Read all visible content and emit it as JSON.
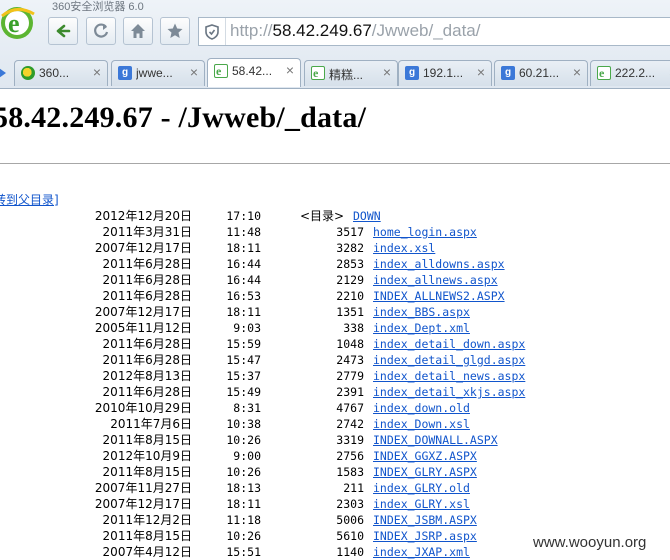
{
  "app": {
    "title": "360安全浏览器 6.0"
  },
  "address": {
    "prefix": "http://",
    "host": "58.42.249.67",
    "path": "/Jwweb/_data/"
  },
  "tabs": [
    {
      "label": "360...",
      "icon": "360-icon",
      "active": false
    },
    {
      "label": "jwwe...",
      "icon": "g-icon",
      "active": false
    },
    {
      "label": "58.42...",
      "icon": "page-icon",
      "active": true
    },
    {
      "label": "精糕...",
      "icon": "page-icon",
      "active": false
    },
    {
      "label": "192.1...",
      "icon": "g-icon",
      "active": false
    },
    {
      "label": "60.21...",
      "icon": "g-icon",
      "active": false
    },
    {
      "label": "222.2...",
      "icon": "page-icon",
      "active": false
    }
  ],
  "page": {
    "title": "58.42.249.67 - /Jwweb/_data/",
    "parent_link": "转到父目录]"
  },
  "listing": [
    {
      "date": "2012年12月20日",
      "time": "17:10",
      "dir_tag": "<目录>",
      "name": "DOWN"
    },
    {
      "date": "2011年3月31日",
      "time": "11:48",
      "size": "3517",
      "name": "home_login.aspx"
    },
    {
      "date": "2007年12月17日",
      "time": "18:11",
      "size": "3282",
      "name": "index.xsl"
    },
    {
      "date": "2011年6月28日",
      "time": "16:44",
      "size": "2853",
      "name": "index_alldowns.aspx"
    },
    {
      "date": "2011年6月28日",
      "time": "16:44",
      "size": "2129",
      "name": "index_allnews.aspx"
    },
    {
      "date": "2011年6月28日",
      "time": "16:53",
      "size": "2210",
      "name": "INDEX_ALLNEWS2.ASPX"
    },
    {
      "date": "2007年12月17日",
      "time": "18:11",
      "size": "1351",
      "name": "index_BBS.aspx"
    },
    {
      "date": "2005年11月12日",
      "time": "9:03",
      "size": "338",
      "name": "index_Dept.xml"
    },
    {
      "date": "2011年6月28日",
      "time": "15:59",
      "size": "1048",
      "name": "index_detail_down.aspx"
    },
    {
      "date": "2011年6月28日",
      "time": "15:47",
      "size": "2473",
      "name": "index_detail_glgd.aspx"
    },
    {
      "date": "2012年8月13日",
      "time": "15:37",
      "size": "2779",
      "name": "index_detail_news.aspx"
    },
    {
      "date": "2011年6月28日",
      "time": "15:49",
      "size": "2391",
      "name": "index_detail_xkjs.aspx"
    },
    {
      "date": "2010年10月29日",
      "time": "8:31",
      "size": "4767",
      "name": "index_down.old"
    },
    {
      "date": "2011年7月6日",
      "time": "10:38",
      "size": "2742",
      "name": "index_Down.xsl"
    },
    {
      "date": "2011年8月15日",
      "time": "10:26",
      "size": "3319",
      "name": "INDEX_DOWNALL.ASPX"
    },
    {
      "date": "2012年10月9日",
      "time": "9:00",
      "size": "2756",
      "name": "INDEX_GGXZ.ASPX"
    },
    {
      "date": "2011年8月15日",
      "time": "10:26",
      "size": "1583",
      "name": "INDEX_GLRY.ASPX"
    },
    {
      "date": "2007年11月27日",
      "time": "18:13",
      "size": "211",
      "name": "index_GLRY.old"
    },
    {
      "date": "2007年12月17日",
      "time": "18:11",
      "size": "2303",
      "name": "index_GLRY.xsl"
    },
    {
      "date": "2011年12月2日",
      "time": "11:18",
      "size": "5006",
      "name": "INDEX_JSBM.ASPX"
    },
    {
      "date": "2011年8月15日",
      "time": "10:26",
      "size": "5610",
      "name": "INDEX_JSRP.aspx"
    },
    {
      "date": "2007年4月12日",
      "time": "15:51",
      "size": "1140",
      "name": "index_JXAP.xml"
    }
  ],
  "watermark": "www.wooyun.org"
}
